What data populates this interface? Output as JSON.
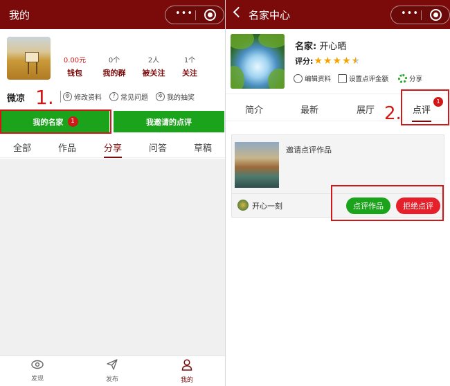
{
  "left": {
    "header": {
      "title": "我的"
    },
    "stats": [
      {
        "value": "0.00元",
        "label": "钱包"
      },
      {
        "value": "0个",
        "label": "我的群"
      },
      {
        "value": "2人",
        "label": "被关注"
      },
      {
        "value": "1个",
        "label": "关注"
      }
    ],
    "username": "微凉",
    "annotation": "1.",
    "links": {
      "edit": "修改资料",
      "faq": "常见问题",
      "lottery": "我的抽奖"
    },
    "buttons": {
      "my_masters": "我的名家",
      "my_masters_badge": "1",
      "my_invited_reviews": "我邀请的点评"
    },
    "tabs": [
      "全部",
      "作品",
      "分享",
      "问答",
      "草稿"
    ],
    "active_tab": "分享",
    "bottom_nav": [
      {
        "label": "发现",
        "icon": "eye-icon"
      },
      {
        "label": "发布",
        "icon": "paper-plane-icon"
      },
      {
        "label": "我的",
        "icon": "person-icon"
      }
    ]
  },
  "right": {
    "header": {
      "title": "名家中心"
    },
    "profile": {
      "name_label": "名家:",
      "name": "开心晒",
      "rating_label": "评分:",
      "rating": 4.5
    },
    "links": {
      "edit": "编辑资料",
      "set_fee": "设置点评金额",
      "share": "分享"
    },
    "tabs": [
      "简介",
      "最新",
      "展厅",
      "点评"
    ],
    "active_tab": "点评",
    "tab_badge": "1",
    "annotation": "2.",
    "card": {
      "title": "邀请点评作品",
      "user": "开心一刻",
      "accept": "点评作品",
      "reject": "拒绝点评"
    }
  },
  "colors": {
    "header": "#7b0b0b",
    "green": "#1ca31c",
    "red": "#d01818",
    "star": "#f3a300"
  }
}
